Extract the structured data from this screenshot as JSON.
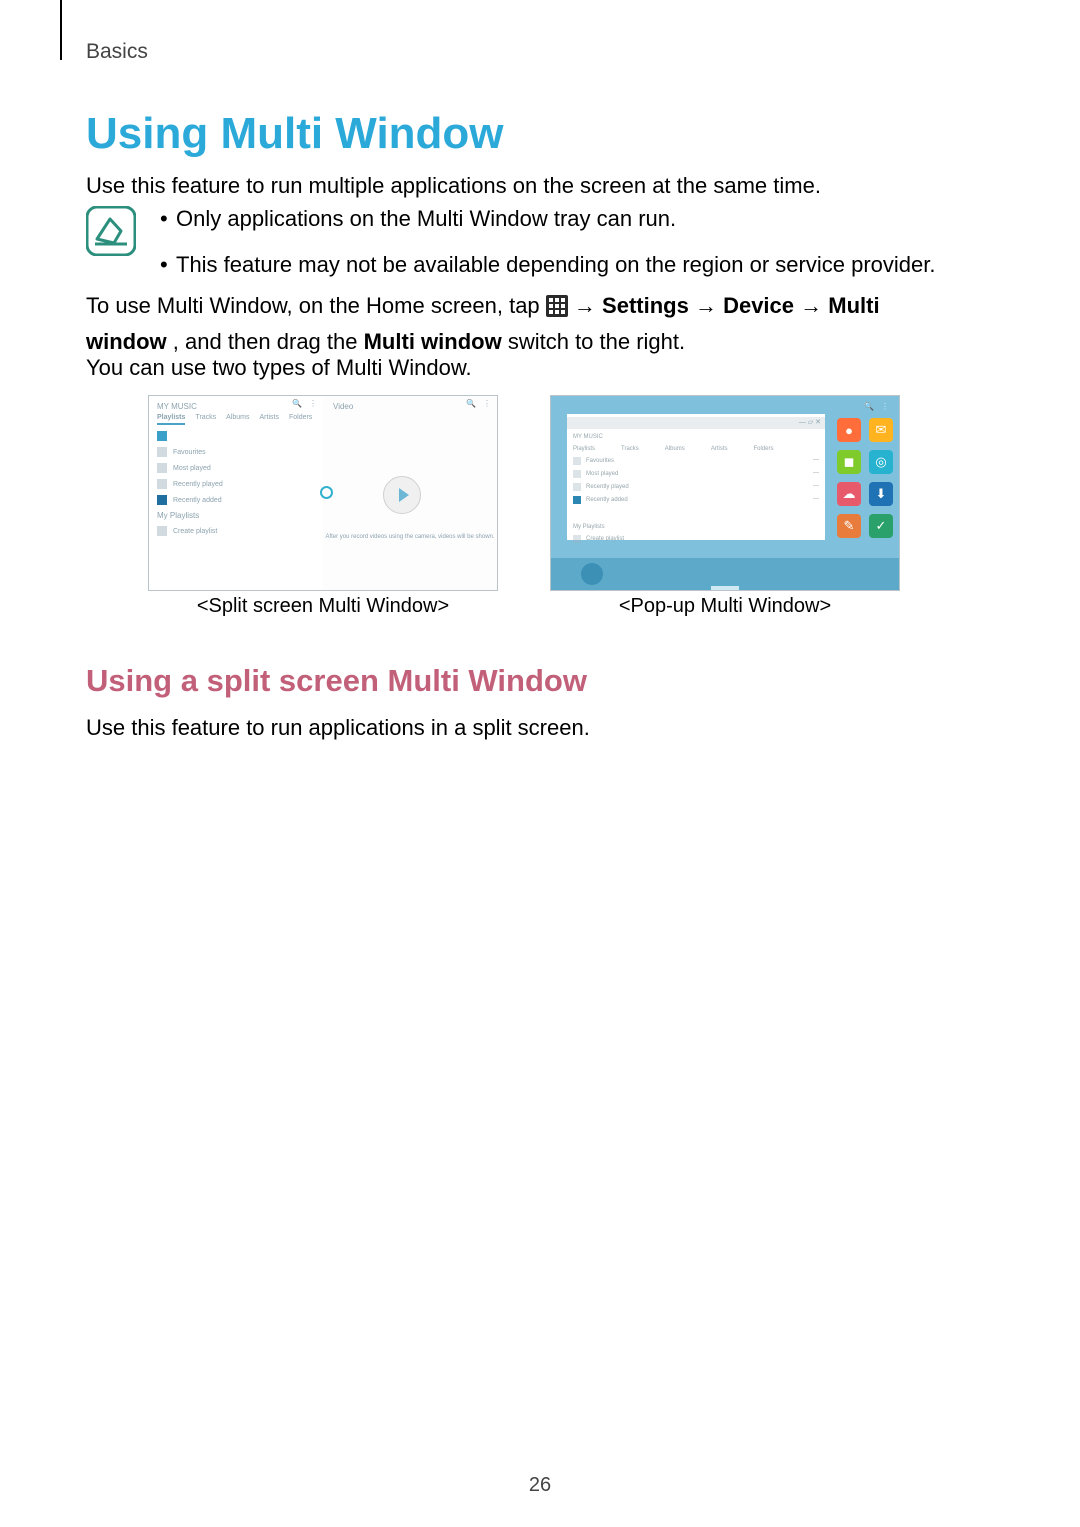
{
  "section": "Basics",
  "h1": "Using Multi Window",
  "intro": "Use this feature to run multiple applications on the screen at the same time.",
  "notes": {
    "a": "Only applications on the Multi Window tray can run.",
    "b": "This feature may not be available depending on the region or service provider."
  },
  "instruction": {
    "prefix": "To use Multi Window, on the Home screen, tap ",
    "arrow": " → ",
    "s1": "Settings",
    "s2": "Device",
    "s3": "Multi window",
    "suffix1": ", and then drag the ",
    "bold_switch": "Multi window",
    "suffix2": " switch to the right."
  },
  "p3": "You can use two types of Multi Window.",
  "captions": {
    "split": "<Split screen Multi Window>",
    "popup": "<Pop-up Multi Window>"
  },
  "fig1": {
    "my_music": "MY MUSIC",
    "tabs": [
      "Playlists",
      "Tracks",
      "Albums",
      "Artists",
      "Folders"
    ],
    "rows": [
      "Favourites",
      "Most played",
      "Recently played",
      "Recently added"
    ],
    "section2": "My Playlists",
    "row2": "Create playlist",
    "video": "Video",
    "play_hint": "After you record videos using the camera, videos will be shown."
  },
  "fig2": {
    "hdr": "MY MUSIC",
    "tabs": [
      "Playlists",
      "Tracks",
      "Albums",
      "Artists",
      "Folders"
    ],
    "rows": [
      "Favourites",
      "Most played",
      "Recently played",
      "Recently added"
    ],
    "section2": "My Playlists",
    "row2": "Create playlist"
  },
  "tray_icons": [
    {
      "bg": "#ff6d3a",
      "glyph": "●"
    },
    {
      "bg": "#7ecb2b",
      "glyph": "◼"
    },
    {
      "bg": "#e75a6c",
      "glyph": "☁"
    },
    {
      "bg": "#e77c3c",
      "glyph": "✎"
    },
    {
      "bg": "#ffb41f",
      "glyph": "✉"
    },
    {
      "bg": "#27b3cf",
      "glyph": "◎"
    },
    {
      "bg": "#1f72b4",
      "glyph": "⬇"
    },
    {
      "bg": "#2aa06b",
      "glyph": "✓"
    }
  ],
  "h2": "Using a split screen Multi Window",
  "p4": "Use this feature to run applications in a split screen.",
  "page_number": "26"
}
